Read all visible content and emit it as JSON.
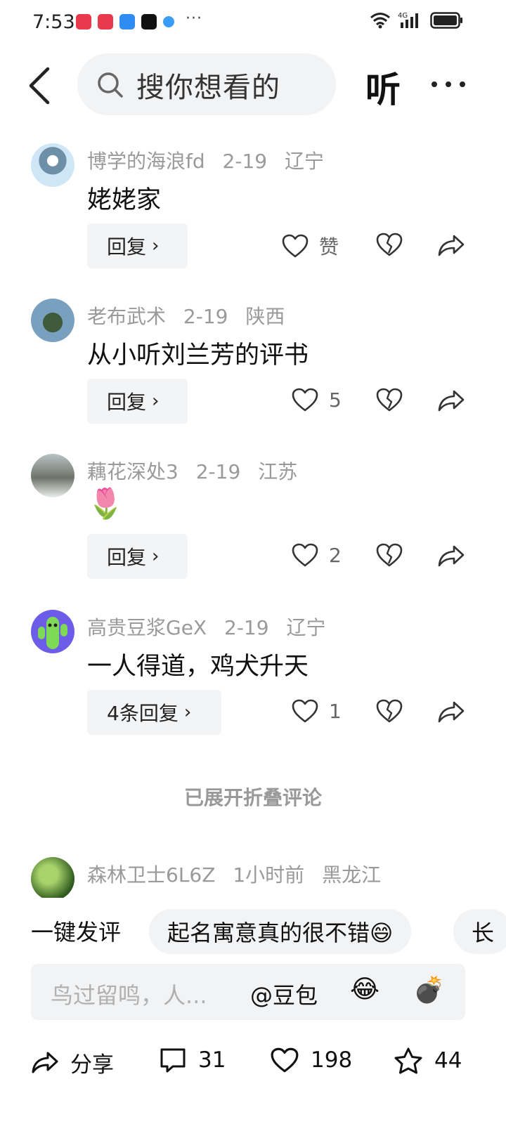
{
  "status_bar": {
    "time": "7:53",
    "dots": "···",
    "network": "4G"
  },
  "header": {
    "search_text": "搜你想看的",
    "listen_label": "听"
  },
  "comments": [
    {
      "username": "博学的海浪fd",
      "date": "2-19",
      "location": "辽宁",
      "text": "姥姥家",
      "reply_label": "回复",
      "like_label": "赞",
      "avatar_colors": [
        "#cfe6f7",
        "#6d8fa8"
      ]
    },
    {
      "username": "老布武术",
      "date": "2-19",
      "location": "陕西",
      "text": "从小听刘兰芳的评书",
      "reply_label": "回复",
      "like_label": "5",
      "avatar_colors": [
        "#7aa0c0",
        "#3d5a3a"
      ]
    },
    {
      "username": "藕花深处3",
      "date": "2-19",
      "location": "江苏",
      "text": "🌷",
      "reply_label": "回复",
      "like_label": "2",
      "avatar_colors": [
        "#9aa5a8",
        "#4b4f4a"
      ]
    },
    {
      "username": "高贵豆浆GeX",
      "date": "2-19",
      "location": "辽宁",
      "text": "一人得道，鸡犬升天",
      "reply_label": "4条回复",
      "like_label": "1",
      "avatar_colors": [
        "#6c5ce7",
        "#7ed957"
      ]
    },
    {
      "username": "森林卫士6L6Z",
      "date": "1小时前",
      "location": "黑龙江",
      "text": "",
      "avatar_colors": [
        "#7fb04a",
        "#2f5a1e"
      ]
    }
  ],
  "fold_notice": "已展开折叠评论",
  "quick_comments": {
    "label": "一键发评",
    "chips": [
      "起名寓意真的很不错😄",
      "长"
    ]
  },
  "input_bar": {
    "placeholder": "鸟过留鸣，人...",
    "at_label": "@豆包",
    "emoji": "😂",
    "bomb": "💣"
  },
  "bottom_bar": {
    "share_label": "分享",
    "comment_count": "31",
    "like_count": "198",
    "favorite_count": "44"
  }
}
